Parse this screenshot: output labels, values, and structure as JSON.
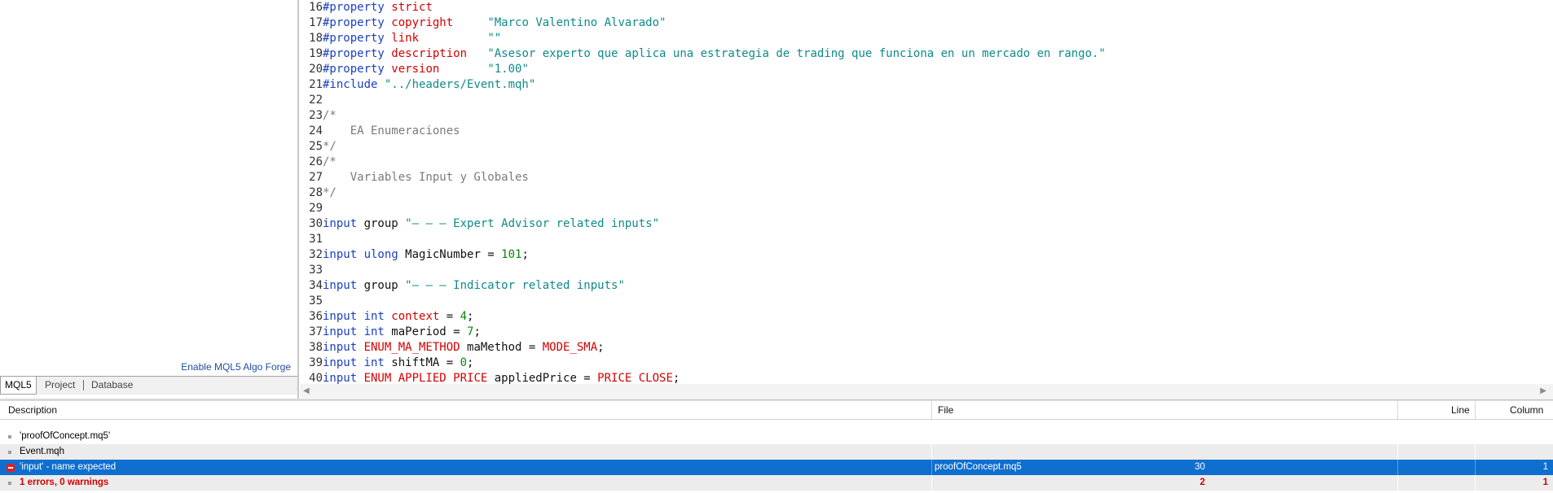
{
  "navigator": {
    "enable_link": "Enable MQL5 Algo Forge",
    "tabs": [
      "MQL5",
      "Project",
      "Database"
    ]
  },
  "editor": {
    "lines": [
      {
        "n": "16",
        "segs": [
          [
            "pp",
            "#property "
          ],
          [
            "red",
            "strict"
          ]
        ]
      },
      {
        "n": "17",
        "segs": [
          [
            "pp",
            "#property "
          ],
          [
            "red",
            "copyright"
          ],
          [
            "plain",
            "     "
          ],
          [
            "str",
            "\"Marco Valentino Alvarado\""
          ]
        ]
      },
      {
        "n": "18",
        "segs": [
          [
            "pp",
            "#property "
          ],
          [
            "red",
            "link"
          ],
          [
            "plain",
            "          "
          ],
          [
            "str",
            "\"\""
          ]
        ]
      },
      {
        "n": "19",
        "segs": [
          [
            "pp",
            "#property "
          ],
          [
            "red",
            "description"
          ],
          [
            "plain",
            "   "
          ],
          [
            "str",
            "\"Asesor experto que aplica una estrategia de trading que funciona en un mercado en rango.\""
          ]
        ]
      },
      {
        "n": "20",
        "segs": [
          [
            "pp",
            "#property "
          ],
          [
            "red",
            "version"
          ],
          [
            "plain",
            "       "
          ],
          [
            "str",
            "\"1.00\""
          ]
        ]
      },
      {
        "n": "21",
        "segs": [
          [
            "pp",
            "#include "
          ],
          [
            "str",
            "\"../headers/Event.mqh\""
          ]
        ]
      },
      {
        "n": "22",
        "segs": []
      },
      {
        "n": "23",
        "segs": [
          [
            "cmt",
            "/*"
          ]
        ]
      },
      {
        "n": "24",
        "segs": [
          [
            "cmt",
            "    EA Enumeraciones"
          ]
        ]
      },
      {
        "n": "25",
        "segs": [
          [
            "cmt",
            "*/"
          ]
        ]
      },
      {
        "n": "26",
        "segs": [
          [
            "cmt",
            "/*"
          ]
        ]
      },
      {
        "n": "27",
        "segs": [
          [
            "cmt",
            "    Variables Input y Globales"
          ]
        ]
      },
      {
        "n": "28",
        "segs": [
          [
            "cmt",
            "*/"
          ]
        ]
      },
      {
        "n": "29",
        "segs": []
      },
      {
        "n": "30",
        "segs": [
          [
            "kw",
            "input "
          ],
          [
            "plain",
            "group "
          ],
          [
            "str",
            "\"– – – Expert Advisor related inputs\""
          ]
        ]
      },
      {
        "n": "31",
        "segs": []
      },
      {
        "n": "32",
        "segs": [
          [
            "kw",
            "input "
          ],
          [
            "kw",
            "ulong "
          ],
          [
            "plain",
            "MagicNumber = "
          ],
          [
            "num",
            "101"
          ],
          [
            "plain",
            ";"
          ]
        ]
      },
      {
        "n": "33",
        "segs": []
      },
      {
        "n": "34",
        "segs": [
          [
            "kw",
            "input "
          ],
          [
            "plain",
            "group "
          ],
          [
            "str",
            "\"– – – Indicator related inputs\""
          ]
        ]
      },
      {
        "n": "35",
        "segs": []
      },
      {
        "n": "36",
        "segs": [
          [
            "kw",
            "input "
          ],
          [
            "kw",
            "int "
          ],
          [
            "red",
            "context"
          ],
          [
            "plain",
            " = "
          ],
          [
            "num",
            "4"
          ],
          [
            "plain",
            ";"
          ]
        ]
      },
      {
        "n": "37",
        "segs": [
          [
            "kw",
            "input "
          ],
          [
            "kw",
            "int "
          ],
          [
            "plain",
            "maPeriod = "
          ],
          [
            "num",
            "7"
          ],
          [
            "plain",
            ";"
          ]
        ]
      },
      {
        "n": "38",
        "segs": [
          [
            "kw",
            "input "
          ],
          [
            "red",
            "ENUM_MA_METHOD "
          ],
          [
            "plain",
            "maMethod = "
          ],
          [
            "red",
            "MODE_SMA"
          ],
          [
            "plain",
            ";"
          ]
        ]
      },
      {
        "n": "39",
        "segs": [
          [
            "kw",
            "input "
          ],
          [
            "kw",
            "int "
          ],
          [
            "plain",
            "shiftMA = "
          ],
          [
            "num",
            "0"
          ],
          [
            "plain",
            ";"
          ]
        ]
      },
      {
        "n": "40",
        "segs": [
          [
            "kw",
            "input "
          ],
          [
            "red",
            "ENUM_APPLIED_PRICE "
          ],
          [
            "plain",
            "appliedPrice = "
          ],
          [
            "red",
            "PRICE_CLOSE"
          ],
          [
            "plain",
            ";"
          ]
        ]
      }
    ],
    "scroll_left": "◀",
    "scroll_right": "▶"
  },
  "toolbox": {
    "headers": {
      "description": "Description",
      "file": "File",
      "line": "Line",
      "column": "Column"
    },
    "rows": [
      {
        "description": "'proofOfConcept.mq5'",
        "file": "",
        "line": "",
        "column": ""
      },
      {
        "description": "Event.mqh",
        "file": "",
        "line": "",
        "column": ""
      },
      {
        "description": "'input' - name expected",
        "file": "proofOfConcept.mq5",
        "line": "30",
        "column": "1"
      },
      {
        "description": "1 errors, 0 warnings",
        "file": "",
        "line": "2",
        "column": "1"
      }
    ]
  },
  "colors": {
    "selection": "#0f6fcf",
    "error": "#d40000",
    "keyword": "#1a3fc4",
    "string": "#0f8a8a",
    "number": "#088808",
    "comment": "#7a7a7a"
  }
}
